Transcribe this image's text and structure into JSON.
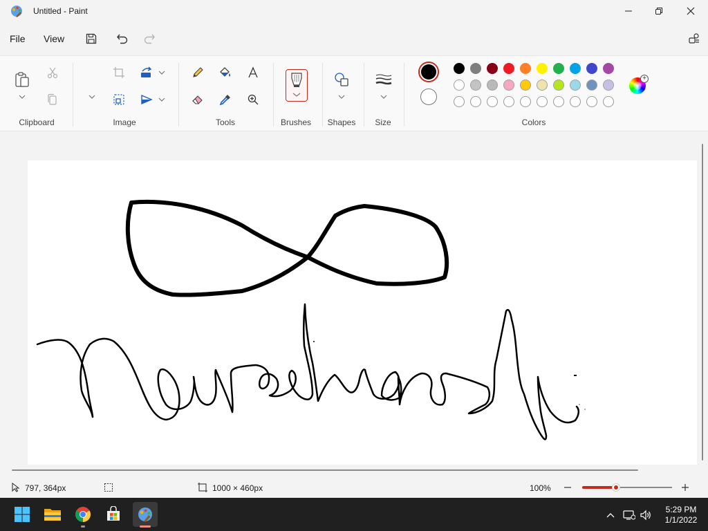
{
  "window": {
    "title": "Untitled - Paint"
  },
  "menu": {
    "file": "File",
    "view": "View"
  },
  "ribbon": {
    "groups": {
      "clipboard": "Clipboard",
      "image": "Image",
      "tools": "Tools",
      "brushes": "Brushes",
      "shapes": "Shapes",
      "size": "Size",
      "colors": "Colors"
    },
    "palette": {
      "row1": [
        "#000000",
        "#7f7f7f",
        "#880015",
        "#ed1c24",
        "#ff7f27",
        "#fff200",
        "#22b14c",
        "#00a2e8",
        "#3f48cc",
        "#a349a4"
      ],
      "row2": [
        "#ffffff",
        "#c3c3c3",
        "#b9b9b9",
        "#f7a6c4",
        "#ffc90e",
        "#efe4b0",
        "#b5e61d",
        "#99d9ea",
        "#7092be",
        "#c8bfe7"
      ],
      "row3_empty_count": 10
    },
    "primary_color": "#000000",
    "secondary_color": "#ffffff",
    "accent": "#c42b1c"
  },
  "status": {
    "cursor_pos": "797, 364px",
    "canvas_size": "1000 × 460px",
    "zoom": "100%",
    "zoom_level": 0.38
  },
  "taskbar": {
    "time": "5:29 PM",
    "date": "1/1/2022",
    "apps": [
      "windows-start",
      "file-explorer",
      "chrome",
      "microsoft-store",
      "paint"
    ]
  }
}
